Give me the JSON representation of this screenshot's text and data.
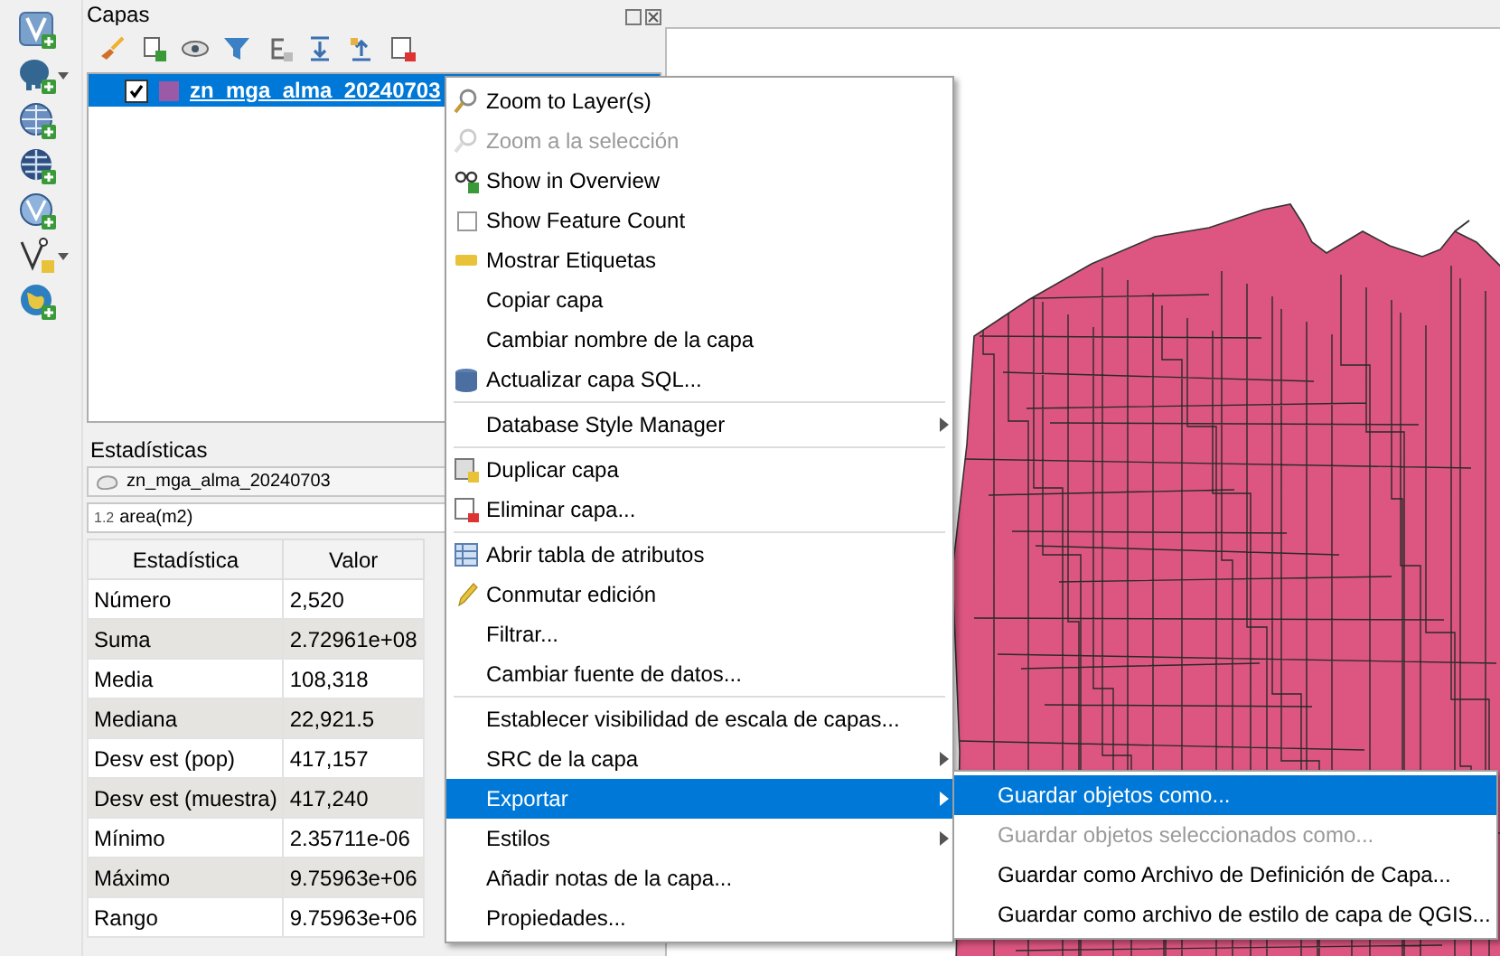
{
  "layers_panel": {
    "title": "Capas",
    "layers": [
      {
        "name": "zn_mga_alma_20240703",
        "checked": true,
        "selected": true,
        "color": "#9b5aa5"
      }
    ]
  },
  "statistics": {
    "title": "Estadísticas",
    "layer": "zn_mga_alma_20240703",
    "field_type": "1.2",
    "field": "area(m2)",
    "columns": [
      "Estadística",
      "Valor"
    ],
    "rows": [
      [
        "Número",
        "2,520"
      ],
      [
        "Suma",
        "2.72961e+08"
      ],
      [
        "Media",
        "108,318"
      ],
      [
        "Mediana",
        "22,921.5"
      ],
      [
        "Desv est (pop)",
        "417,157"
      ],
      [
        "Desv est (muestra)",
        "417,240"
      ],
      [
        "Mínimo",
        "2.35711e-06"
      ],
      [
        "Máximo",
        "9.75963e+06"
      ],
      [
        "Rango",
        "9.75963e+06"
      ]
    ]
  },
  "context_menu": {
    "items": [
      {
        "kind": "item",
        "label": "Zoom to Layer(s)",
        "disabled": false,
        "submenu": false,
        "selected": false
      },
      {
        "kind": "item",
        "label": "Zoom a la selección",
        "disabled": true,
        "submenu": false,
        "selected": false
      },
      {
        "kind": "item",
        "label": "Show in Overview",
        "disabled": false,
        "submenu": false,
        "selected": false
      },
      {
        "kind": "check",
        "label": "Show Feature Count",
        "checked": false,
        "disabled": false,
        "submenu": false,
        "selected": false
      },
      {
        "kind": "item",
        "label": "Mostrar Etiquetas",
        "disabled": false,
        "submenu": false,
        "selected": false
      },
      {
        "kind": "item",
        "label": "Copiar capa",
        "disabled": false,
        "submenu": false,
        "selected": false
      },
      {
        "kind": "item",
        "label": "Cambiar nombre de la capa",
        "disabled": false,
        "submenu": false,
        "selected": false
      },
      {
        "kind": "item",
        "label": "Actualizar capa SQL...",
        "disabled": false,
        "submenu": false,
        "selected": false
      },
      {
        "kind": "separator"
      },
      {
        "kind": "item",
        "label": "Database Style Manager",
        "disabled": false,
        "submenu": true,
        "selected": false
      },
      {
        "kind": "separator"
      },
      {
        "kind": "item",
        "label": "Duplicar capa",
        "disabled": false,
        "submenu": false,
        "selected": false
      },
      {
        "kind": "item",
        "label": "Eliminar capa...",
        "disabled": false,
        "submenu": false,
        "selected": false
      },
      {
        "kind": "separator"
      },
      {
        "kind": "item",
        "label": "Abrir tabla de atributos",
        "disabled": false,
        "submenu": false,
        "selected": false
      },
      {
        "kind": "item",
        "label": "Conmutar edición",
        "disabled": false,
        "submenu": false,
        "selected": false
      },
      {
        "kind": "item",
        "label": "Filtrar...",
        "disabled": false,
        "submenu": false,
        "selected": false
      },
      {
        "kind": "item",
        "label": "Cambiar fuente de datos...",
        "disabled": false,
        "submenu": false,
        "selected": false
      },
      {
        "kind": "separator"
      },
      {
        "kind": "item",
        "label": "Establecer visibilidad de escala de capas...",
        "disabled": false,
        "submenu": false,
        "selected": false
      },
      {
        "kind": "item",
        "label": "SRC de la capa",
        "disabled": false,
        "submenu": true,
        "selected": false
      },
      {
        "kind": "item",
        "label": "Exportar",
        "disabled": false,
        "submenu": true,
        "selected": true
      },
      {
        "kind": "item",
        "label": "Estilos",
        "disabled": false,
        "submenu": true,
        "selected": false
      },
      {
        "kind": "item",
        "label": "Añadir notas de la capa...",
        "disabled": false,
        "submenu": false,
        "selected": false
      },
      {
        "kind": "item",
        "label": "Propiedades...",
        "disabled": false,
        "submenu": false,
        "selected": false
      }
    ]
  },
  "submenu": {
    "items": [
      {
        "label": "Guardar objetos como...",
        "disabled": false,
        "selected": true
      },
      {
        "label": "Guardar objetos seleccionados como...",
        "disabled": true,
        "selected": false
      },
      {
        "label": "Guardar como Archivo de Definición de Capa...",
        "disabled": false,
        "selected": false
      },
      {
        "label": "Guardar como archivo de estilo de capa de QGIS...",
        "disabled": false,
        "selected": false
      }
    ]
  }
}
